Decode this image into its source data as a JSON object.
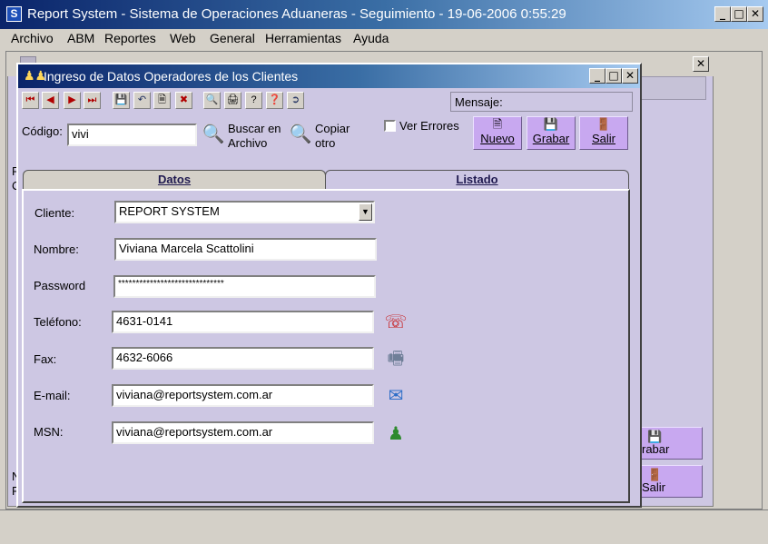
{
  "app": {
    "title": "Report System - Sistema de Operaciones Aduaneras - Seguimiento - 19-06-2006 0:55:29",
    "icon_letter": "S"
  },
  "window_controls": {
    "minimize": "_",
    "maximize": "□",
    "close": "✕"
  },
  "menu": [
    "Archivo",
    "ABM",
    "Reportes",
    "Web",
    "General",
    "Herramientas",
    "Ayuda"
  ],
  "background": {
    "left_fragments": [
      "F",
      "C",
      "N",
      "F"
    ],
    "button_grabar": "rabar",
    "button_salir": "Salir"
  },
  "dialog": {
    "title": "Ingreso de Datos Operadores de los Clientes",
    "toolbar_icons": [
      "first-icon",
      "prev-icon",
      "next-icon",
      "last-icon",
      "save-icon",
      "undo-icon",
      "new-icon",
      "delete-icon",
      "search-icon",
      "print-icon",
      "help-icon",
      "whats-this-icon",
      "exit-icon"
    ],
    "mensaje_label": "Mensaje:",
    "codigo_label": "Código:",
    "codigo_value": "vivi",
    "buscar_label_1": "Buscar en",
    "buscar_label_2": "Archivo",
    "copiar_label_1": "Copiar",
    "copiar_label_2": "otro",
    "ver_errores_label": "Ver Errores",
    "ver_errores_checked": false,
    "btn_nuevo": "Nuevo",
    "btn_grabar": "Grabar",
    "btn_salir": "Salir",
    "tabs": [
      {
        "label": "Datos",
        "active": true
      },
      {
        "label": "Listado",
        "active": false
      }
    ],
    "form": {
      "cliente_label": "Cliente:",
      "cliente_value": "REPORT SYSTEM",
      "nombre_label": "Nombre:",
      "nombre_value": "Viviana Marcela Scattolini",
      "password_label": "Password",
      "password_value": "******************************",
      "telefono_label": "Teléfono:",
      "telefono_value": "4631-0141",
      "fax_label": "Fax:",
      "fax_value": "4632-6066",
      "email_label": "E-mail:",
      "email_value": "viviana@reportsystem.com.ar",
      "msn_label": "MSN:",
      "msn_value": "viviana@reportsystem.com.ar"
    }
  },
  "colors": {
    "titlebar_start": "#0a246a",
    "titlebar_end": "#a6caf0",
    "form_background": "#cdc7e3",
    "button_purple": "#c8a8f0",
    "window_face": "#d4d0c8"
  }
}
